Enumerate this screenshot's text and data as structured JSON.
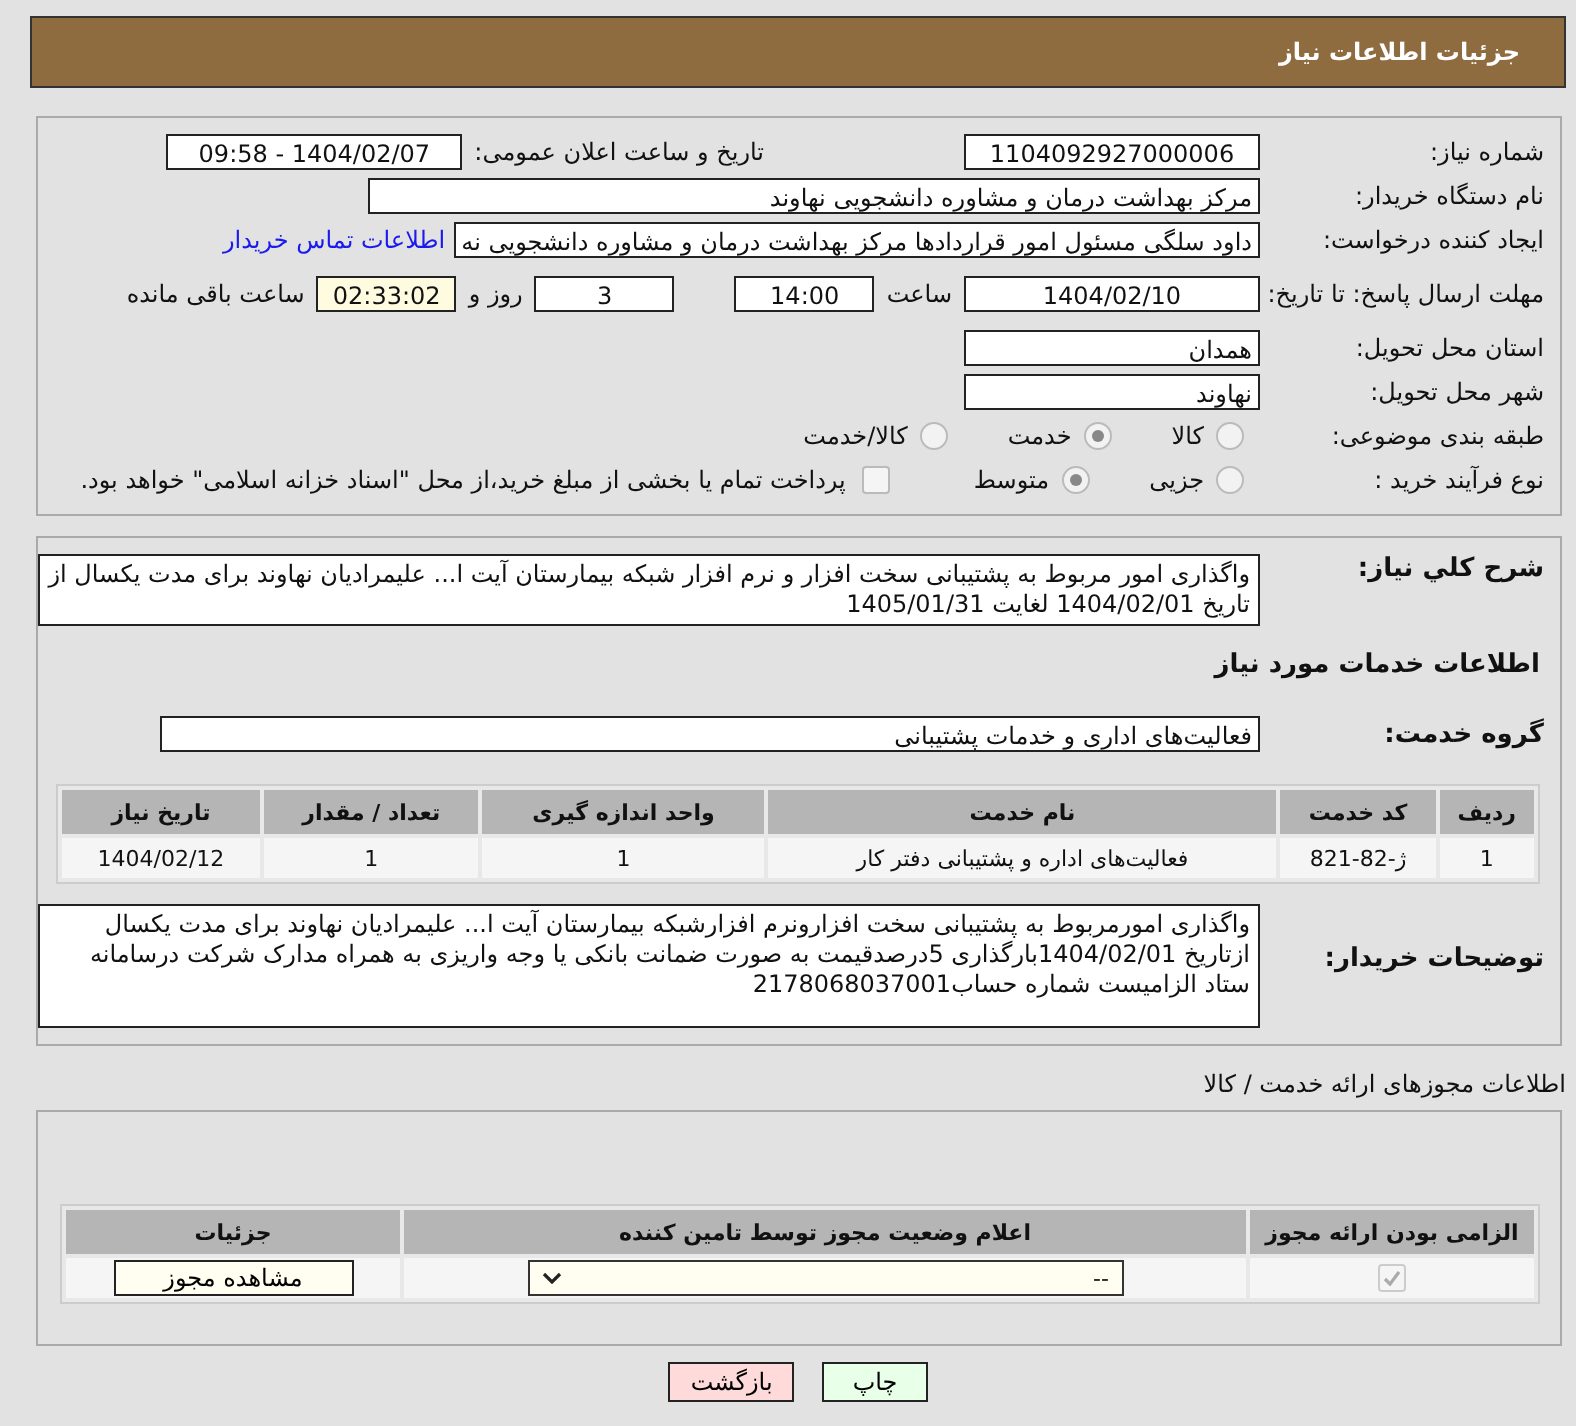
{
  "header": {
    "title": "جزئیات اطلاعات نیاز"
  },
  "need_number": {
    "label": "شماره نیاز:",
    "value": "1104092927000006"
  },
  "announce_datetime": {
    "label": "تاریخ و ساعت اعلان عمومی:",
    "value": "1404/02/07 - 09:58"
  },
  "buyer_org": {
    "label": "نام دستگاه خریدار:",
    "value": "مرکز بهداشت  درمان و مشاوره دانشجویی نهاوند"
  },
  "requester": {
    "label": "ایجاد کننده درخواست:",
    "value": "داود سلگی مسئول امور قراردادها مرکز بهداشت  درمان و مشاوره دانشجویی نه",
    "contact_link": "اطلاعات تماس خریدار"
  },
  "deadline": {
    "label": "مهلت ارسال پاسخ: تا تاریخ:",
    "date": "1404/02/10",
    "time_label": "ساعت",
    "time": "14:00",
    "days": "3",
    "days_label": "روز و",
    "remaining": "02:33:02",
    "remaining_label": "ساعت باقی مانده"
  },
  "province": {
    "label": "استان محل تحویل:",
    "value": "همدان"
  },
  "city": {
    "label": "شهر محل تحویل:",
    "value": "نهاوند"
  },
  "category": {
    "label": "طبقه بندی موضوعی:",
    "options": [
      {
        "label": "کالا",
        "selected": false
      },
      {
        "label": "خدمت",
        "selected": true
      },
      {
        "label": "کالا/خدمت",
        "selected": false
      }
    ]
  },
  "purchase_type": {
    "label": "نوع فرآیند خرید :",
    "options": [
      {
        "label": "جزیی",
        "selected": false
      },
      {
        "label": "متوسط",
        "selected": true
      }
    ],
    "payment_checkbox": {
      "label": "پرداخت تمام یا بخشی از مبلغ خرید،از محل \"اسناد خزانه اسلامی\" خواهد بود.",
      "checked": false
    }
  },
  "general_description": {
    "label": "شرح کلي نياز:",
    "value": "واگذاری امور مربوط به پشتیبانی سخت افزار و نرم افزار شبکه بیمارستان آیت ا... علیمرادیان نهاوند برای مدت یکسال از تاریخ 1404/02/01 لغایت 1405/01/31"
  },
  "services_heading": "اطلاعات خدمات مورد نیاز",
  "service_group": {
    "label": "گروه خدمت:",
    "value": "فعالیت‌های اداری و خدمات پشتیبانی"
  },
  "services_table": {
    "columns": [
      "ردیف",
      "کد خدمت",
      "نام خدمت",
      "واحد اندازه گیری",
      "تعداد / مقدار",
      "تاریخ نیاز"
    ],
    "rows": [
      [
        "1",
        "ژ-82-821",
        "فعالیت‌های اداره و پشتیبانی دفتر کار",
        "1",
        "1",
        "1404/02/12"
      ]
    ]
  },
  "buyer_notes": {
    "label": "توضیحات خریدار:",
    "value": "واگذاری امورمربوط به پشتیبانی سخت افزارونرم افزارشبکه بیمارستان آیت ا... علیمرادیان نهاوند برای مدت یکسال ازتاریخ 1404/02/01بارگذاری 5درصدقیمت به صورت ضمانت بانکی یا وجه واریزی به همراه مدارک شرکت درسامانه ستاد الزامیست شماره حساب2178068037001"
  },
  "permits_heading": "اطلاعات مجوزهای ارائه خدمت / کالا",
  "permits_table": {
    "columns": [
      "الزامی بودن ارائه مجوز",
      "اعلام وضعیت مجوز توسط تامین کننده",
      "جزئیات"
    ],
    "rows": [
      {
        "required": true,
        "status": "--",
        "details": "مشاهده مجوز"
      }
    ]
  },
  "buttons": [
    {
      "label": "چاپ",
      "kind": "print"
    },
    {
      "label": "بازگشت",
      "kind": "back"
    }
  ]
}
